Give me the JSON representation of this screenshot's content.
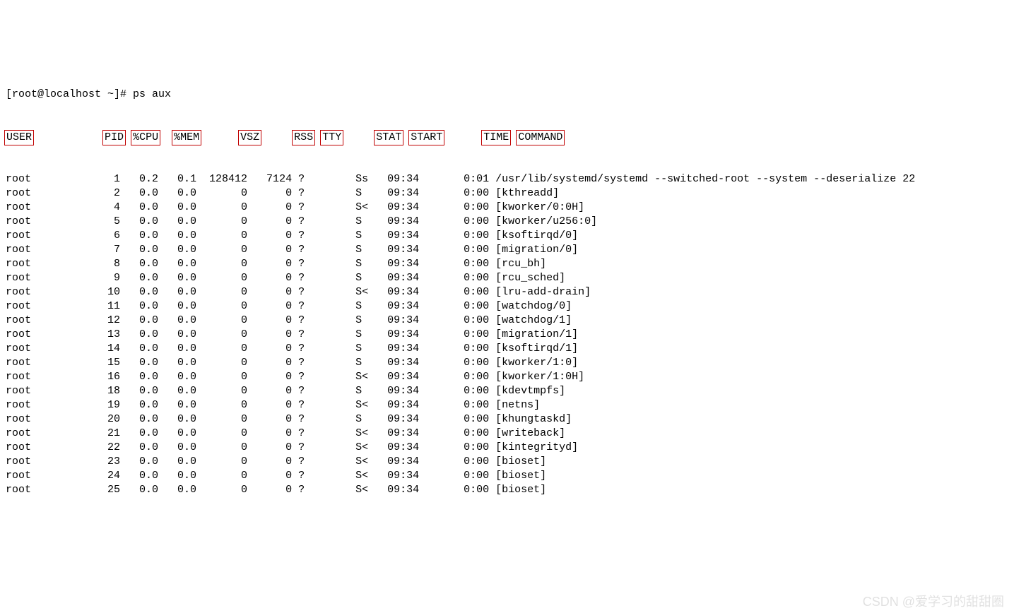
{
  "prompt": "[root@localhost ~]# ps aux",
  "cols": {
    "user": {
      "label": "USER",
      "width": 5
    },
    "pid": {
      "label": "PID",
      "width": 7
    },
    "cpu": {
      "label": "%CPU",
      "width": 5
    },
    "mem": {
      "label": "%MEM",
      "width": 5
    },
    "vsz": {
      "label": "VSZ",
      "width": 7
    },
    "rss": {
      "label": "RSS",
      "width": 6
    },
    "tty": {
      "label": "TTY",
      "width": 4
    },
    "stat": {
      "label": "STAT",
      "width": 5
    },
    "start": {
      "label": "START",
      "width": 7
    },
    "time": {
      "label": "TIME",
      "width": 5
    },
    "cmd": {
      "label": "COMMAND",
      "width": 0
    }
  },
  "rows": [
    {
      "user": "root",
      "pid": 1,
      "cpu": "0.2",
      "mem": "0.1",
      "vsz": 128412,
      "rss": 7124,
      "tty": "?",
      "stat": "Ss",
      "start": "09:34",
      "time": "0:01",
      "cmd": "/usr/lib/systemd/systemd --switched-root --system --deserialize 22"
    },
    {
      "user": "root",
      "pid": 2,
      "cpu": "0.0",
      "mem": "0.0",
      "vsz": 0,
      "rss": 0,
      "tty": "?",
      "stat": "S",
      "start": "09:34",
      "time": "0:00",
      "cmd": "[kthreadd]"
    },
    {
      "user": "root",
      "pid": 4,
      "cpu": "0.0",
      "mem": "0.0",
      "vsz": 0,
      "rss": 0,
      "tty": "?",
      "stat": "S<",
      "start": "09:34",
      "time": "0:00",
      "cmd": "[kworker/0:0H]"
    },
    {
      "user": "root",
      "pid": 5,
      "cpu": "0.0",
      "mem": "0.0",
      "vsz": 0,
      "rss": 0,
      "tty": "?",
      "stat": "S",
      "start": "09:34",
      "time": "0:00",
      "cmd": "[kworker/u256:0]"
    },
    {
      "user": "root",
      "pid": 6,
      "cpu": "0.0",
      "mem": "0.0",
      "vsz": 0,
      "rss": 0,
      "tty": "?",
      "stat": "S",
      "start": "09:34",
      "time": "0:00",
      "cmd": "[ksoftirqd/0]"
    },
    {
      "user": "root",
      "pid": 7,
      "cpu": "0.0",
      "mem": "0.0",
      "vsz": 0,
      "rss": 0,
      "tty": "?",
      "stat": "S",
      "start": "09:34",
      "time": "0:00",
      "cmd": "[migration/0]"
    },
    {
      "user": "root",
      "pid": 8,
      "cpu": "0.0",
      "mem": "0.0",
      "vsz": 0,
      "rss": 0,
      "tty": "?",
      "stat": "S",
      "start": "09:34",
      "time": "0:00",
      "cmd": "[rcu_bh]"
    },
    {
      "user": "root",
      "pid": 9,
      "cpu": "0.0",
      "mem": "0.0",
      "vsz": 0,
      "rss": 0,
      "tty": "?",
      "stat": "S",
      "start": "09:34",
      "time": "0:00",
      "cmd": "[rcu_sched]"
    },
    {
      "user": "root",
      "pid": 10,
      "cpu": "0.0",
      "mem": "0.0",
      "vsz": 0,
      "rss": 0,
      "tty": "?",
      "stat": "S<",
      "start": "09:34",
      "time": "0:00",
      "cmd": "[lru-add-drain]"
    },
    {
      "user": "root",
      "pid": 11,
      "cpu": "0.0",
      "mem": "0.0",
      "vsz": 0,
      "rss": 0,
      "tty": "?",
      "stat": "S",
      "start": "09:34",
      "time": "0:00",
      "cmd": "[watchdog/0]"
    },
    {
      "user": "root",
      "pid": 12,
      "cpu": "0.0",
      "mem": "0.0",
      "vsz": 0,
      "rss": 0,
      "tty": "?",
      "stat": "S",
      "start": "09:34",
      "time": "0:00",
      "cmd": "[watchdog/1]"
    },
    {
      "user": "root",
      "pid": 13,
      "cpu": "0.0",
      "mem": "0.0",
      "vsz": 0,
      "rss": 0,
      "tty": "?",
      "stat": "S",
      "start": "09:34",
      "time": "0:00",
      "cmd": "[migration/1]"
    },
    {
      "user": "root",
      "pid": 14,
      "cpu": "0.0",
      "mem": "0.0",
      "vsz": 0,
      "rss": 0,
      "tty": "?",
      "stat": "S",
      "start": "09:34",
      "time": "0:00",
      "cmd": "[ksoftirqd/1]"
    },
    {
      "user": "root",
      "pid": 15,
      "cpu": "0.0",
      "mem": "0.0",
      "vsz": 0,
      "rss": 0,
      "tty": "?",
      "stat": "S",
      "start": "09:34",
      "time": "0:00",
      "cmd": "[kworker/1:0]"
    },
    {
      "user": "root",
      "pid": 16,
      "cpu": "0.0",
      "mem": "0.0",
      "vsz": 0,
      "rss": 0,
      "tty": "?",
      "stat": "S<",
      "start": "09:34",
      "time": "0:00",
      "cmd": "[kworker/1:0H]"
    },
    {
      "user": "root",
      "pid": 18,
      "cpu": "0.0",
      "mem": "0.0",
      "vsz": 0,
      "rss": 0,
      "tty": "?",
      "stat": "S",
      "start": "09:34",
      "time": "0:00",
      "cmd": "[kdevtmpfs]"
    },
    {
      "user": "root",
      "pid": 19,
      "cpu": "0.0",
      "mem": "0.0",
      "vsz": 0,
      "rss": 0,
      "tty": "?",
      "stat": "S<",
      "start": "09:34",
      "time": "0:00",
      "cmd": "[netns]"
    },
    {
      "user": "root",
      "pid": 20,
      "cpu": "0.0",
      "mem": "0.0",
      "vsz": 0,
      "rss": 0,
      "tty": "?",
      "stat": "S",
      "start": "09:34",
      "time": "0:00",
      "cmd": "[khungtaskd]"
    },
    {
      "user": "root",
      "pid": 21,
      "cpu": "0.0",
      "mem": "0.0",
      "vsz": 0,
      "rss": 0,
      "tty": "?",
      "stat": "S<",
      "start": "09:34",
      "time": "0:00",
      "cmd": "[writeback]"
    },
    {
      "user": "root",
      "pid": 22,
      "cpu": "0.0",
      "mem": "0.0",
      "vsz": 0,
      "rss": 0,
      "tty": "?",
      "stat": "S<",
      "start": "09:34",
      "time": "0:00",
      "cmd": "[kintegrityd]"
    },
    {
      "user": "root",
      "pid": 23,
      "cpu": "0.0",
      "mem": "0.0",
      "vsz": 0,
      "rss": 0,
      "tty": "?",
      "stat": "S<",
      "start": "09:34",
      "time": "0:00",
      "cmd": "[bioset]"
    },
    {
      "user": "root",
      "pid": 24,
      "cpu": "0.0",
      "mem": "0.0",
      "vsz": 0,
      "rss": 0,
      "tty": "?",
      "stat": "S<",
      "start": "09:34",
      "time": "0:00",
      "cmd": "[bioset]"
    },
    {
      "user": "root",
      "pid": 25,
      "cpu": "0.0",
      "mem": "0.0",
      "vsz": 0,
      "rss": 0,
      "tty": "?",
      "stat": "S<",
      "start": "09:34",
      "time": "0:00",
      "cmd": "[bioset]"
    }
  ],
  "watermark": "CSDN @爱学习的甜甜圈"
}
